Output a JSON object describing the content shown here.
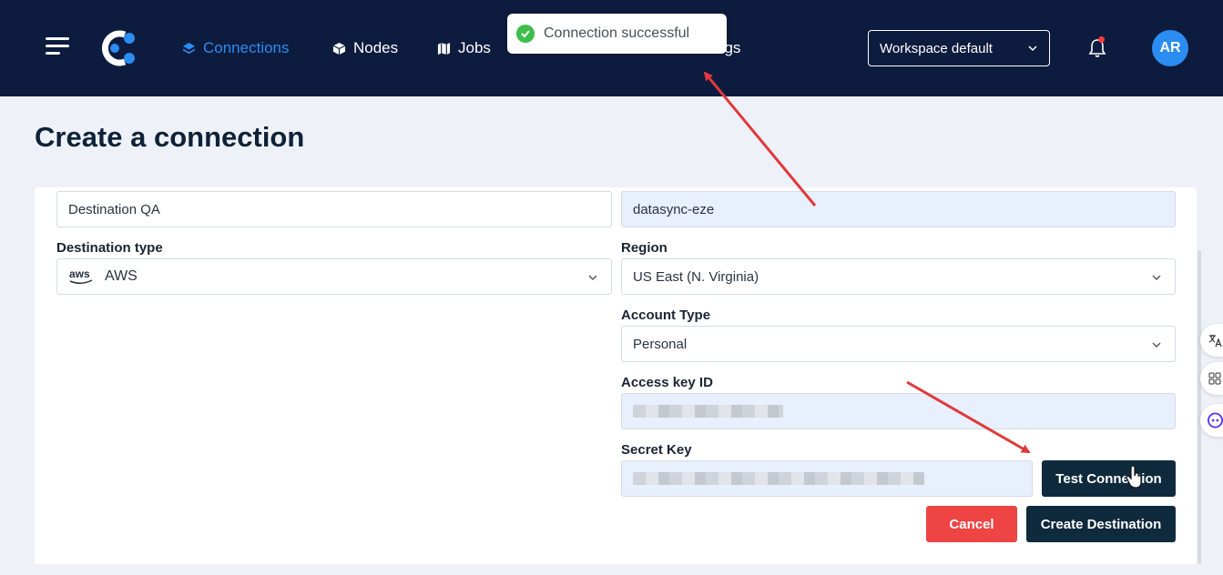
{
  "nav": {
    "items": [
      {
        "label": "Connections",
        "icon": "layers-icon",
        "active": true
      },
      {
        "label": "Nodes",
        "icon": "cube-icon"
      },
      {
        "label": "Jobs",
        "icon": "map-icon"
      },
      {
        "label": "ngs",
        "icon": "settings-icon"
      }
    ],
    "workspace": "Workspace default",
    "avatar": "AR"
  },
  "toast": {
    "message": "Connection successful",
    "color": "#3dbd4a"
  },
  "page": {
    "title": "Create a connection"
  },
  "form": {
    "name_value": "Destination QA",
    "bucket_value": "datasync-eze",
    "destination_type_label": "Destination type",
    "destination_type_value": "AWS",
    "destination_type_icon": "aws",
    "region_label": "Region",
    "region_value": "US East (N. Virginia)",
    "account_type_label": "Account Type",
    "account_type_value": "Personal",
    "access_key_label": "Access key ID",
    "secret_key_label": "Secret Key"
  },
  "buttons": {
    "test": "Test Connection",
    "cancel": "Cancel",
    "create": "Create Destination"
  },
  "colors": {
    "nav_bg": "#0d1b3e",
    "active": "#2b8cf2",
    "primary_btn": "#0f2a3d",
    "cancel_btn": "#ef4444",
    "annotation_arrow": "#e0393b"
  }
}
